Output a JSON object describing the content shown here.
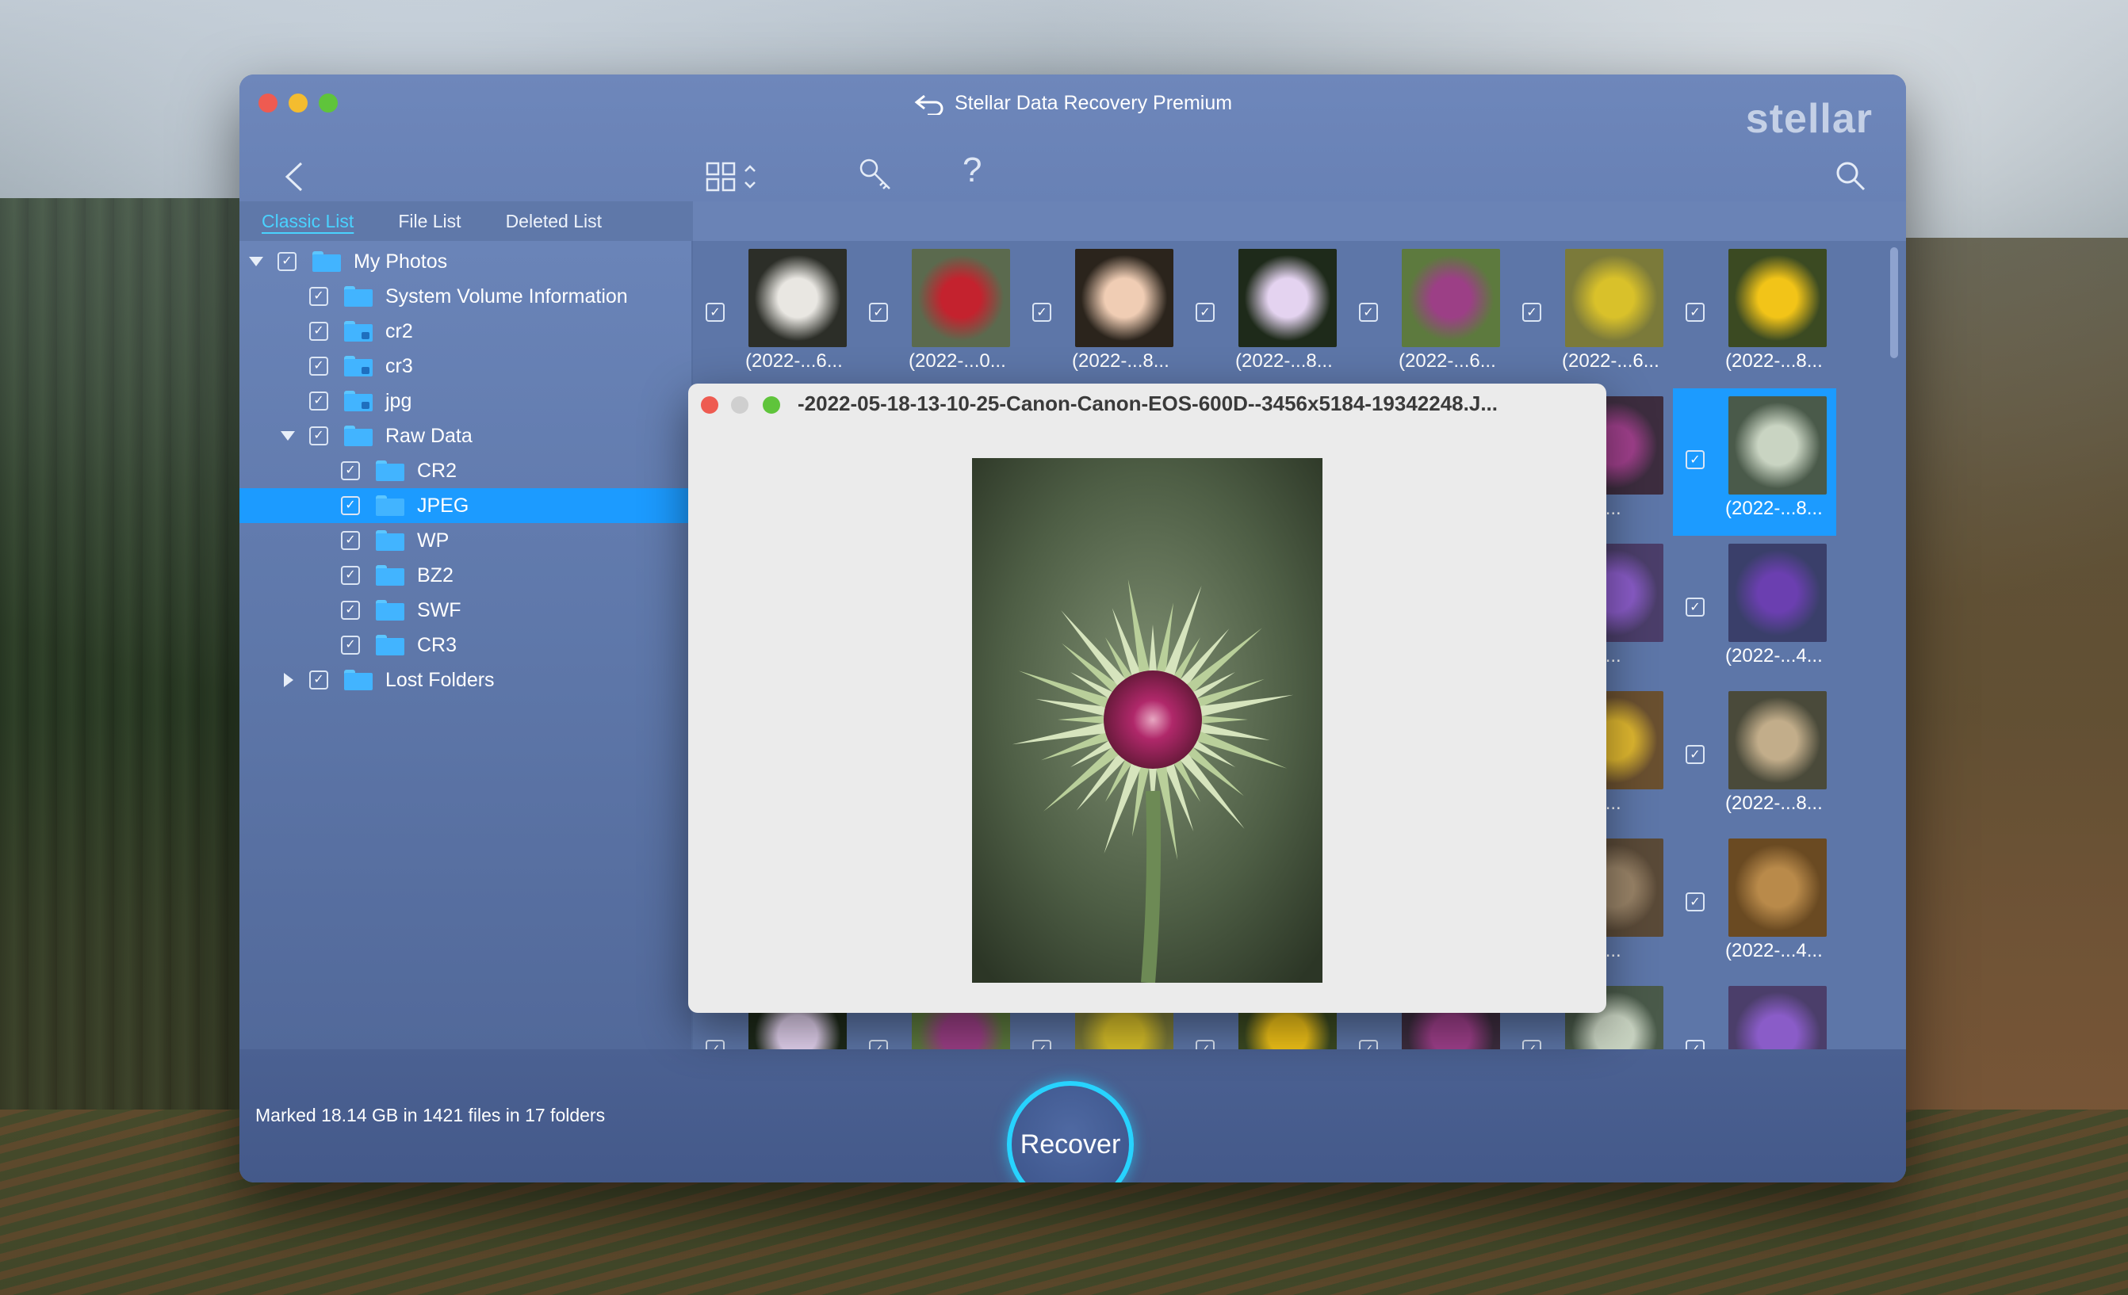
{
  "window": {
    "title": "Stellar Data Recovery Premium",
    "brand": "stellar"
  },
  "toolbar": {
    "back_icon": "chevron-left-icon",
    "view_icon": "grid-view-icon",
    "key_icon": "key-icon",
    "help": "?",
    "search_icon": "search-icon"
  },
  "tabs": [
    {
      "label": "Classic List",
      "active": true
    },
    {
      "label": "File List",
      "active": false
    },
    {
      "label": "Deleted List",
      "active": false
    }
  ],
  "tree": [
    {
      "label": "My Photos",
      "level": 0,
      "expanded": true
    },
    {
      "label": "System Volume Information",
      "level": 1
    },
    {
      "label": "cr2",
      "level": 1,
      "locked": true
    },
    {
      "label": "cr3",
      "level": 1,
      "locked": true
    },
    {
      "label": "jpg",
      "level": 1,
      "locked": true
    },
    {
      "label": "Raw Data",
      "level": 1,
      "expanded": true
    },
    {
      "label": "CR2",
      "level": 2
    },
    {
      "label": "JPEG",
      "level": 2,
      "selected": true
    },
    {
      "label": "WP",
      "level": 2
    },
    {
      "label": "BZ2",
      "level": 2
    },
    {
      "label": "SWF",
      "level": 2
    },
    {
      "label": "CR3",
      "level": 2
    },
    {
      "label": "Lost Folders",
      "level": 1,
      "expanded": false
    }
  ],
  "thumbs_row1": [
    "(2022-...6...",
    "(2022-...0...",
    "(2022-...8...",
    "(2022-...8...",
    "(2022-...6...",
    "(2022-...6...",
    "(2022-...8..."
  ],
  "thumbs_col6": [
    "2-...0...",
    "2-...6...",
    "2-...6...",
    "2-...4..."
  ],
  "thumbs_col7": [
    "(2022-...8...",
    "(2022-...4...",
    "(2022-...8...",
    "(2022-...4..."
  ],
  "preview": {
    "title": "-2022-05-18-13-10-25-Canon-Canon-EOS-600D--3456x5184-19342248.J..."
  },
  "status": {
    "text": "Marked 18.14 GB in 1421 files in 17 folders"
  },
  "recover": {
    "label": "Recover"
  },
  "colors": {
    "accent": "#1c9bff",
    "window_bg": "#5f78a9",
    "recover_ring": "#27d3ff"
  }
}
